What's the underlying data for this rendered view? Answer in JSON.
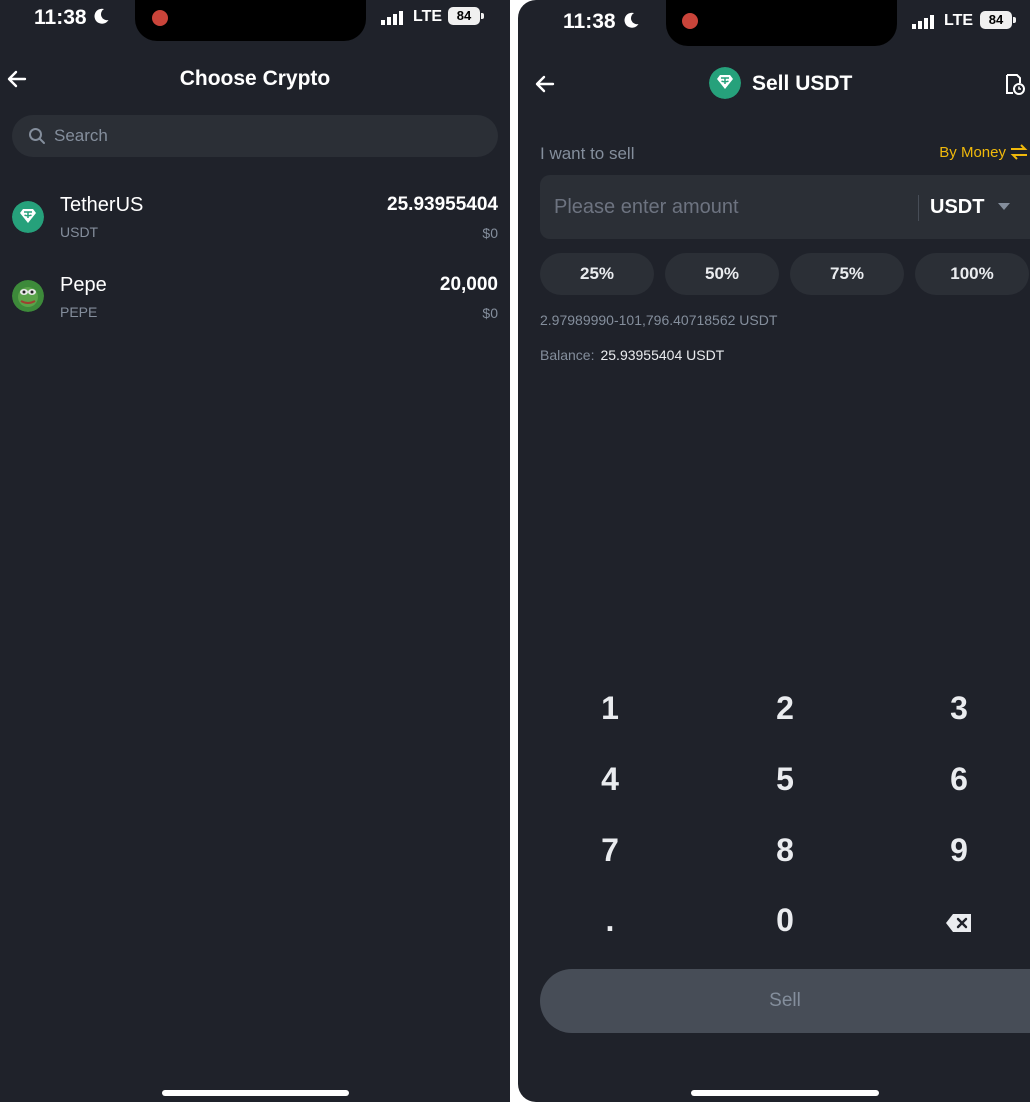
{
  "left": {
    "status": {
      "time": "11:38",
      "network": "LTE",
      "battery": "84"
    },
    "header": {
      "title": "Choose Crypto"
    },
    "search": {
      "placeholder": "Search"
    },
    "coins": [
      {
        "name": "TetherUS",
        "symbol": "USDT",
        "balance": "25.93955404",
        "fiat": "$0",
        "icon": "tether-logo"
      },
      {
        "name": "Pepe",
        "symbol": "PEPE",
        "balance": "20,000",
        "fiat": "$0",
        "icon": "pepe-logo"
      }
    ]
  },
  "right": {
    "status": {
      "time": "11:38",
      "network": "LTE",
      "battery": "84"
    },
    "header": {
      "title": "Sell USDT"
    },
    "form": {
      "label": "I want to sell",
      "mode_toggle": "By Money",
      "amount_placeholder": "Please enter amount",
      "unit": "USDT",
      "percent_options": [
        "25%",
        "50%",
        "75%",
        "100%"
      ],
      "range": "2.97989990-101,796.40718562 USDT",
      "balance_label": "Balance:",
      "balance_value": "25.93955404 USDT"
    },
    "keypad": [
      "1",
      "2",
      "3",
      "4",
      "5",
      "6",
      "7",
      "8",
      "9",
      ".",
      "0",
      "backspace"
    ],
    "sell_button": "Sell"
  },
  "colors": {
    "background": "#1f222a",
    "surface": "#2b2f36",
    "accent": "#f0b90b",
    "tether": "#26a17b",
    "record": "#c9443a"
  }
}
